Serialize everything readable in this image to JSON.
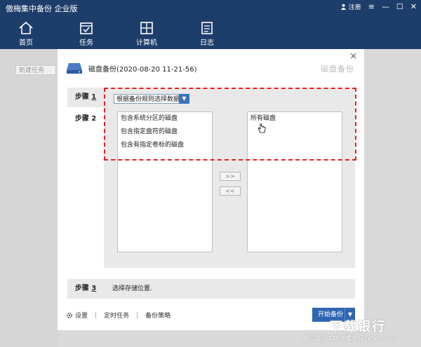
{
  "app": {
    "title": "傲梅集中备份 企业版",
    "user_label": "注册"
  },
  "nav": [
    {
      "label": "首页",
      "icon": "home-icon"
    },
    {
      "label": "任务",
      "icon": "calendar-icon"
    },
    {
      "label": "计算机",
      "icon": "windows-icon"
    },
    {
      "label": "日志",
      "icon": "log-icon"
    }
  ],
  "left_panel": {
    "new_task_placeholder": "新建任务"
  },
  "dialog": {
    "heading": "磁盘备份(2020-08-20 11-21-56)",
    "watermark": "磁盘备份",
    "close": "×",
    "steps": [
      {
        "label": "步骤",
        "number": "1"
      },
      {
        "label": "步骤",
        "number": "2"
      },
      {
        "label": "步骤",
        "number": "3"
      }
    ],
    "select_value": "根据备份规则选择数据",
    "left_list": [
      "包含系统分区的磁盘",
      "包含指定盘符的磁盘",
      "包含有指定卷标的磁盘"
    ],
    "right_list": [
      "所有磁盘"
    ],
    "move_right": ">>",
    "move_left": "<<",
    "step3_text": "选择存储位置.",
    "footer": {
      "settings": "设置",
      "schedule": "定时任务",
      "strategy": "备份策略"
    },
    "start_button": "开始备份"
  },
  "site": {
    "logo": "下载银行",
    "sub": "欢迎访问 178 下载银行 (xzyh.com)"
  },
  "colors": {
    "topbar": "#1d3e6a",
    "accent": "#2e66b1",
    "highlight_frame": "#e82020"
  }
}
